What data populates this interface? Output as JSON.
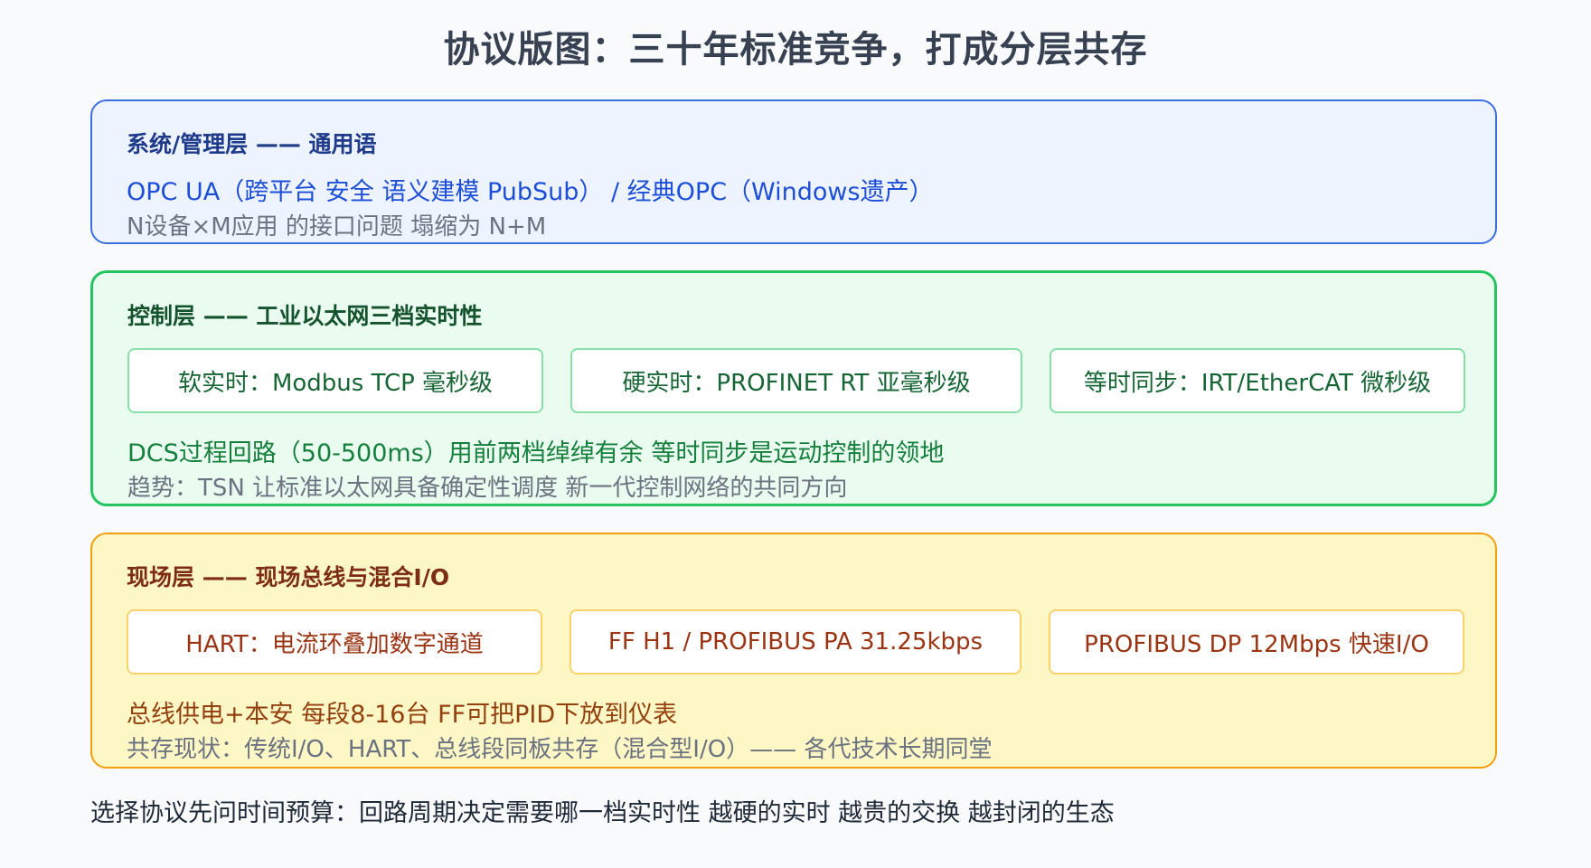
{
  "title": "协议版图：三十年标准竞争，打成分层共存",
  "layers": [
    {
      "heading": "系统/管理层 —— 通用语",
      "line1": "OPC UA（跨平台 安全 语义建模 PubSub） / 经典OPC（Windows遗产）",
      "line2": "N设备×M应用 的接口问题 塌缩为 N+M",
      "border_color": "#3b6fe0",
      "background_color": "#eef4ff"
    },
    {
      "heading": "控制层 —— 工业以太网三档实时性",
      "chips": [
        "软实时：Modbus TCP 毫秒级",
        "硬实时：PROFINET RT 亚毫秒级",
        "等时同步：IRT/EtherCAT 微秒级"
      ],
      "line1": "DCS过程回路（50-500ms）用前两档绰绰有余 等时同步是运动控制的领地",
      "line2": "趋势：TSN 让标准以太网具备确定性调度 新一代控制网络的共同方向",
      "border_color": "#22c55e",
      "background_color": "#eafbf0"
    },
    {
      "heading": "现场层 —— 现场总线与混合I/O",
      "chips": [
        "HART：电流环叠加数字通道",
        "FF H1 / PROFIBUS PA 31.25kbps",
        "PROFIBUS DP 12Mbps 快速I/O"
      ],
      "line1": "总线供电+本安 每段8-16台 FF可把PID下放到仪表",
      "line2": "共存现状：传统I/O、HART、总线段同板共存（混合型I/O）—— 各代技术长期同堂",
      "border_color": "#f59e0b",
      "background_color": "#fdf6c5"
    }
  ],
  "footer": "选择协议先问时间预算：回路周期决定需要哪一档实时性 越硬的实时 越贵的交换 越封闭的生态"
}
